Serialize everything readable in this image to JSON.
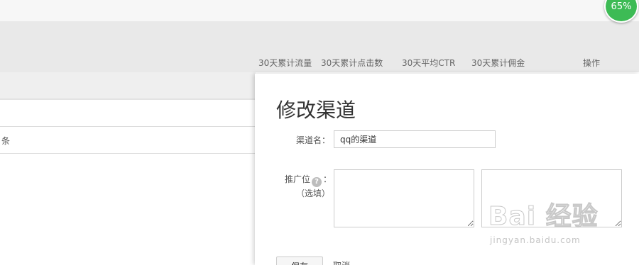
{
  "status": {
    "percent_label": "65%",
    "color": "#3dbb55"
  },
  "table": {
    "columns": [
      "30天累计流量",
      "30天累计点击数",
      "30天平均CTR",
      "30天累计佣金",
      "操作"
    ],
    "row_fragment": "条"
  },
  "modal": {
    "title": "修改渠道",
    "name_label": "渠道名：",
    "name_value": "qq的渠道",
    "position_label": "推广位",
    "position_suffix": "：",
    "help_icon": "question-circle-icon",
    "help_glyph": "?",
    "optional_label": "（选填）",
    "save_label": "保存",
    "cancel_label": "取消"
  },
  "watermark": {
    "main": "Bai 经验",
    "sub": "jingyan.baidu.com"
  }
}
